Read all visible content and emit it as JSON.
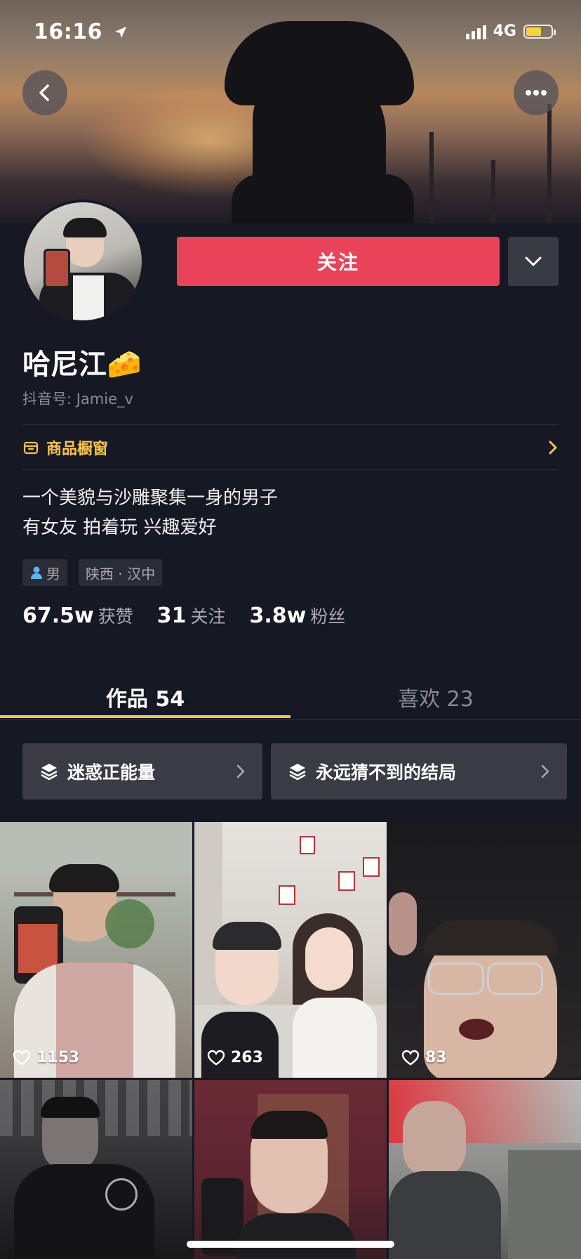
{
  "status_bar": {
    "time": "16:16",
    "network": "4G",
    "battery_level": 0.62
  },
  "header": {
    "back_icon": "chevron-left-icon",
    "more_icon": "ellipsis-icon"
  },
  "profile": {
    "follow_label": "关注",
    "name": "哈尼江🧀",
    "douyin_id": "抖音号: Jamie_v",
    "shop_window_label": "商品橱窗",
    "bio_line1": "一个美貌与沙雕聚集一身的男子",
    "bio_line2": "有女友 拍着玩 兴趣爱好",
    "tags": {
      "gender": "男",
      "location": "陕西 · 汉中"
    },
    "stats": {
      "likes_count": "67.5w",
      "likes_label": "获赞",
      "following_count": "31",
      "following_label": "关注",
      "followers_count": "3.8w",
      "followers_label": "粉丝"
    }
  },
  "tabs": {
    "works": "作品 54",
    "liked": "喜欢 23"
  },
  "collections": [
    {
      "title": "迷惑正能量"
    },
    {
      "title": "永远猜不到的结局"
    }
  ],
  "videos": [
    {
      "likes": "1153"
    },
    {
      "likes": "263"
    },
    {
      "likes": "83"
    },
    {
      "likes": ""
    },
    {
      "likes": ""
    },
    {
      "likes": ""
    }
  ],
  "colors": {
    "background": "#161823",
    "follow_button": "#ea4359",
    "accent_yellow": "#f4c54a"
  }
}
